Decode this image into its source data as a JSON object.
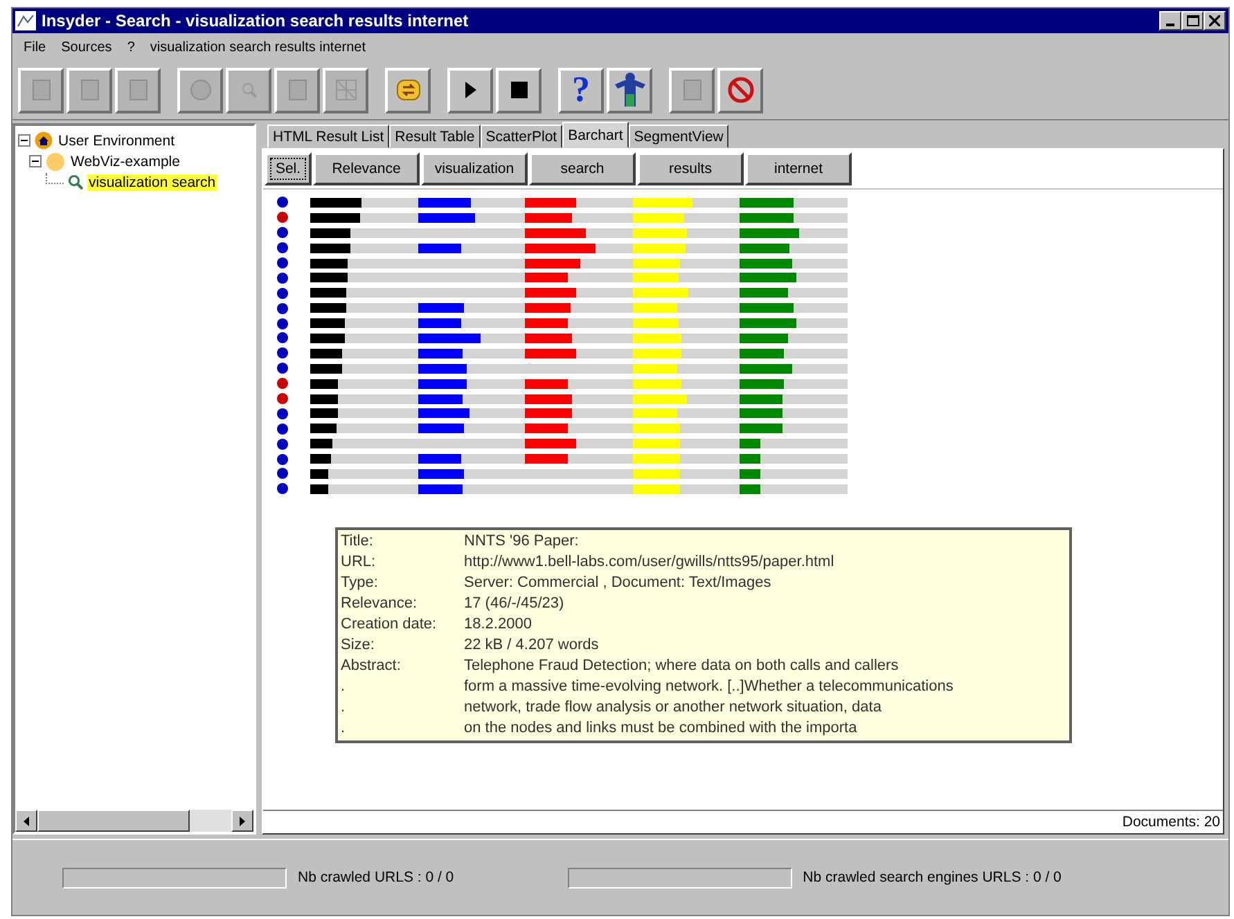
{
  "window": {
    "title": "Insyder - Search - visualization search results internet"
  },
  "menu": [
    "File",
    "Sources",
    "?",
    "visualization search results internet"
  ],
  "toolbar": [
    {
      "kind": "page",
      "disabled": true
    },
    {
      "kind": "page",
      "disabled": true
    },
    {
      "kind": "page",
      "disabled": true
    },
    {
      "kind": "globe",
      "disabled": true
    },
    {
      "kind": "magnifier",
      "disabled": true
    },
    {
      "kind": "page",
      "disabled": true
    },
    {
      "kind": "grid",
      "disabled": true
    },
    {
      "kind": "refresh",
      "disabled": false
    },
    {
      "kind": "play",
      "disabled": false
    },
    {
      "kind": "stop",
      "disabled": false
    },
    {
      "kind": "help",
      "disabled": false,
      "label": "?"
    },
    {
      "kind": "person",
      "disabled": false
    },
    {
      "kind": "page",
      "disabled": true
    },
    {
      "kind": "cancel",
      "disabled": false
    }
  ],
  "tree": [
    {
      "label": "User Environment",
      "expanded": true,
      "selected": false,
      "children": [
        {
          "label": "WebViz-example",
          "expanded": true,
          "selected": false,
          "children": [
            {
              "label": "visualization search",
              "selected": true
            }
          ]
        }
      ]
    }
  ],
  "tabs": [
    {
      "label": "HTML Result List",
      "selected": false
    },
    {
      "label": "Result Table",
      "selected": false
    },
    {
      "label": "ScatterPlot",
      "selected": false
    },
    {
      "label": "Barchart",
      "selected": true
    },
    {
      "label": "SegmentView",
      "selected": false
    }
  ],
  "barchart": {
    "select_button": "Sel.",
    "columns": [
      {
        "label": "Relevance",
        "color": "#000000"
      },
      {
        "label": "visualization",
        "color": "#0000ff"
      },
      {
        "label": "search",
        "color": "#ff0000"
      },
      {
        "label": "results",
        "color": "#ffff00"
      },
      {
        "label": "internet",
        "color": "#008800"
      }
    ],
    "rows": [
      {
        "color": "#0000c0"
      },
      {
        "color": "#cc0000"
      },
      {
        "color": "#0000c0"
      },
      {
        "color": "#0000c0"
      },
      {
        "color": "#0000c0"
      },
      {
        "color": "#0000c0"
      },
      {
        "color": "#0000c0"
      },
      {
        "color": "#0000c0"
      },
      {
        "color": "#0000c0"
      },
      {
        "color": "#0000c0"
      },
      {
        "color": "#0000c0"
      },
      {
        "color": "#0000c0"
      },
      {
        "color": "#cc0000"
      },
      {
        "color": "#cc0000"
      },
      {
        "color": "#0000c0"
      },
      {
        "color": "#0000c0"
      },
      {
        "color": "#0000c0"
      },
      {
        "color": "#0000c0"
      },
      {
        "color": "#0000c0"
      },
      {
        "color": "#0000c0"
      }
    ],
    "details": [
      {
        "label": "Title:",
        "value": "NNTS '96 Paper:"
      },
      {
        "label": "URL:",
        "value": "http://www1.bell-labs.com/user/gwills/ntts95/paper.html"
      },
      {
        "label": "Type:",
        "value": "Server: Commercial , Document: Text/Images"
      },
      {
        "label": "Relevance:",
        "value": "17 (46/-/45/23)"
      },
      {
        "label": "Creation date:",
        "value": "18.2.2000"
      },
      {
        "label": "Size:",
        "value": "22 kB / 4.207 words"
      },
      {
        "label": "Abstract:",
        "value": "Telephone Fraud Detection; where data on both calls and callers"
      },
      {
        "label": ".",
        "value": "form a massive time-evolving network. [..]Whether a telecommunications"
      },
      {
        "label": ".",
        "value": "network, trade flow analysis or another network situation, data"
      },
      {
        "label": ".",
        "value": "on the nodes and links must be combined with the importa"
      }
    ],
    "documents": "Documents: 20"
  },
  "status": [
    {
      "label": "Nb crawled URLS : 0 / 0"
    },
    {
      "label": "Nb crawled search engines URLS : 0 / 0"
    }
  ]
}
